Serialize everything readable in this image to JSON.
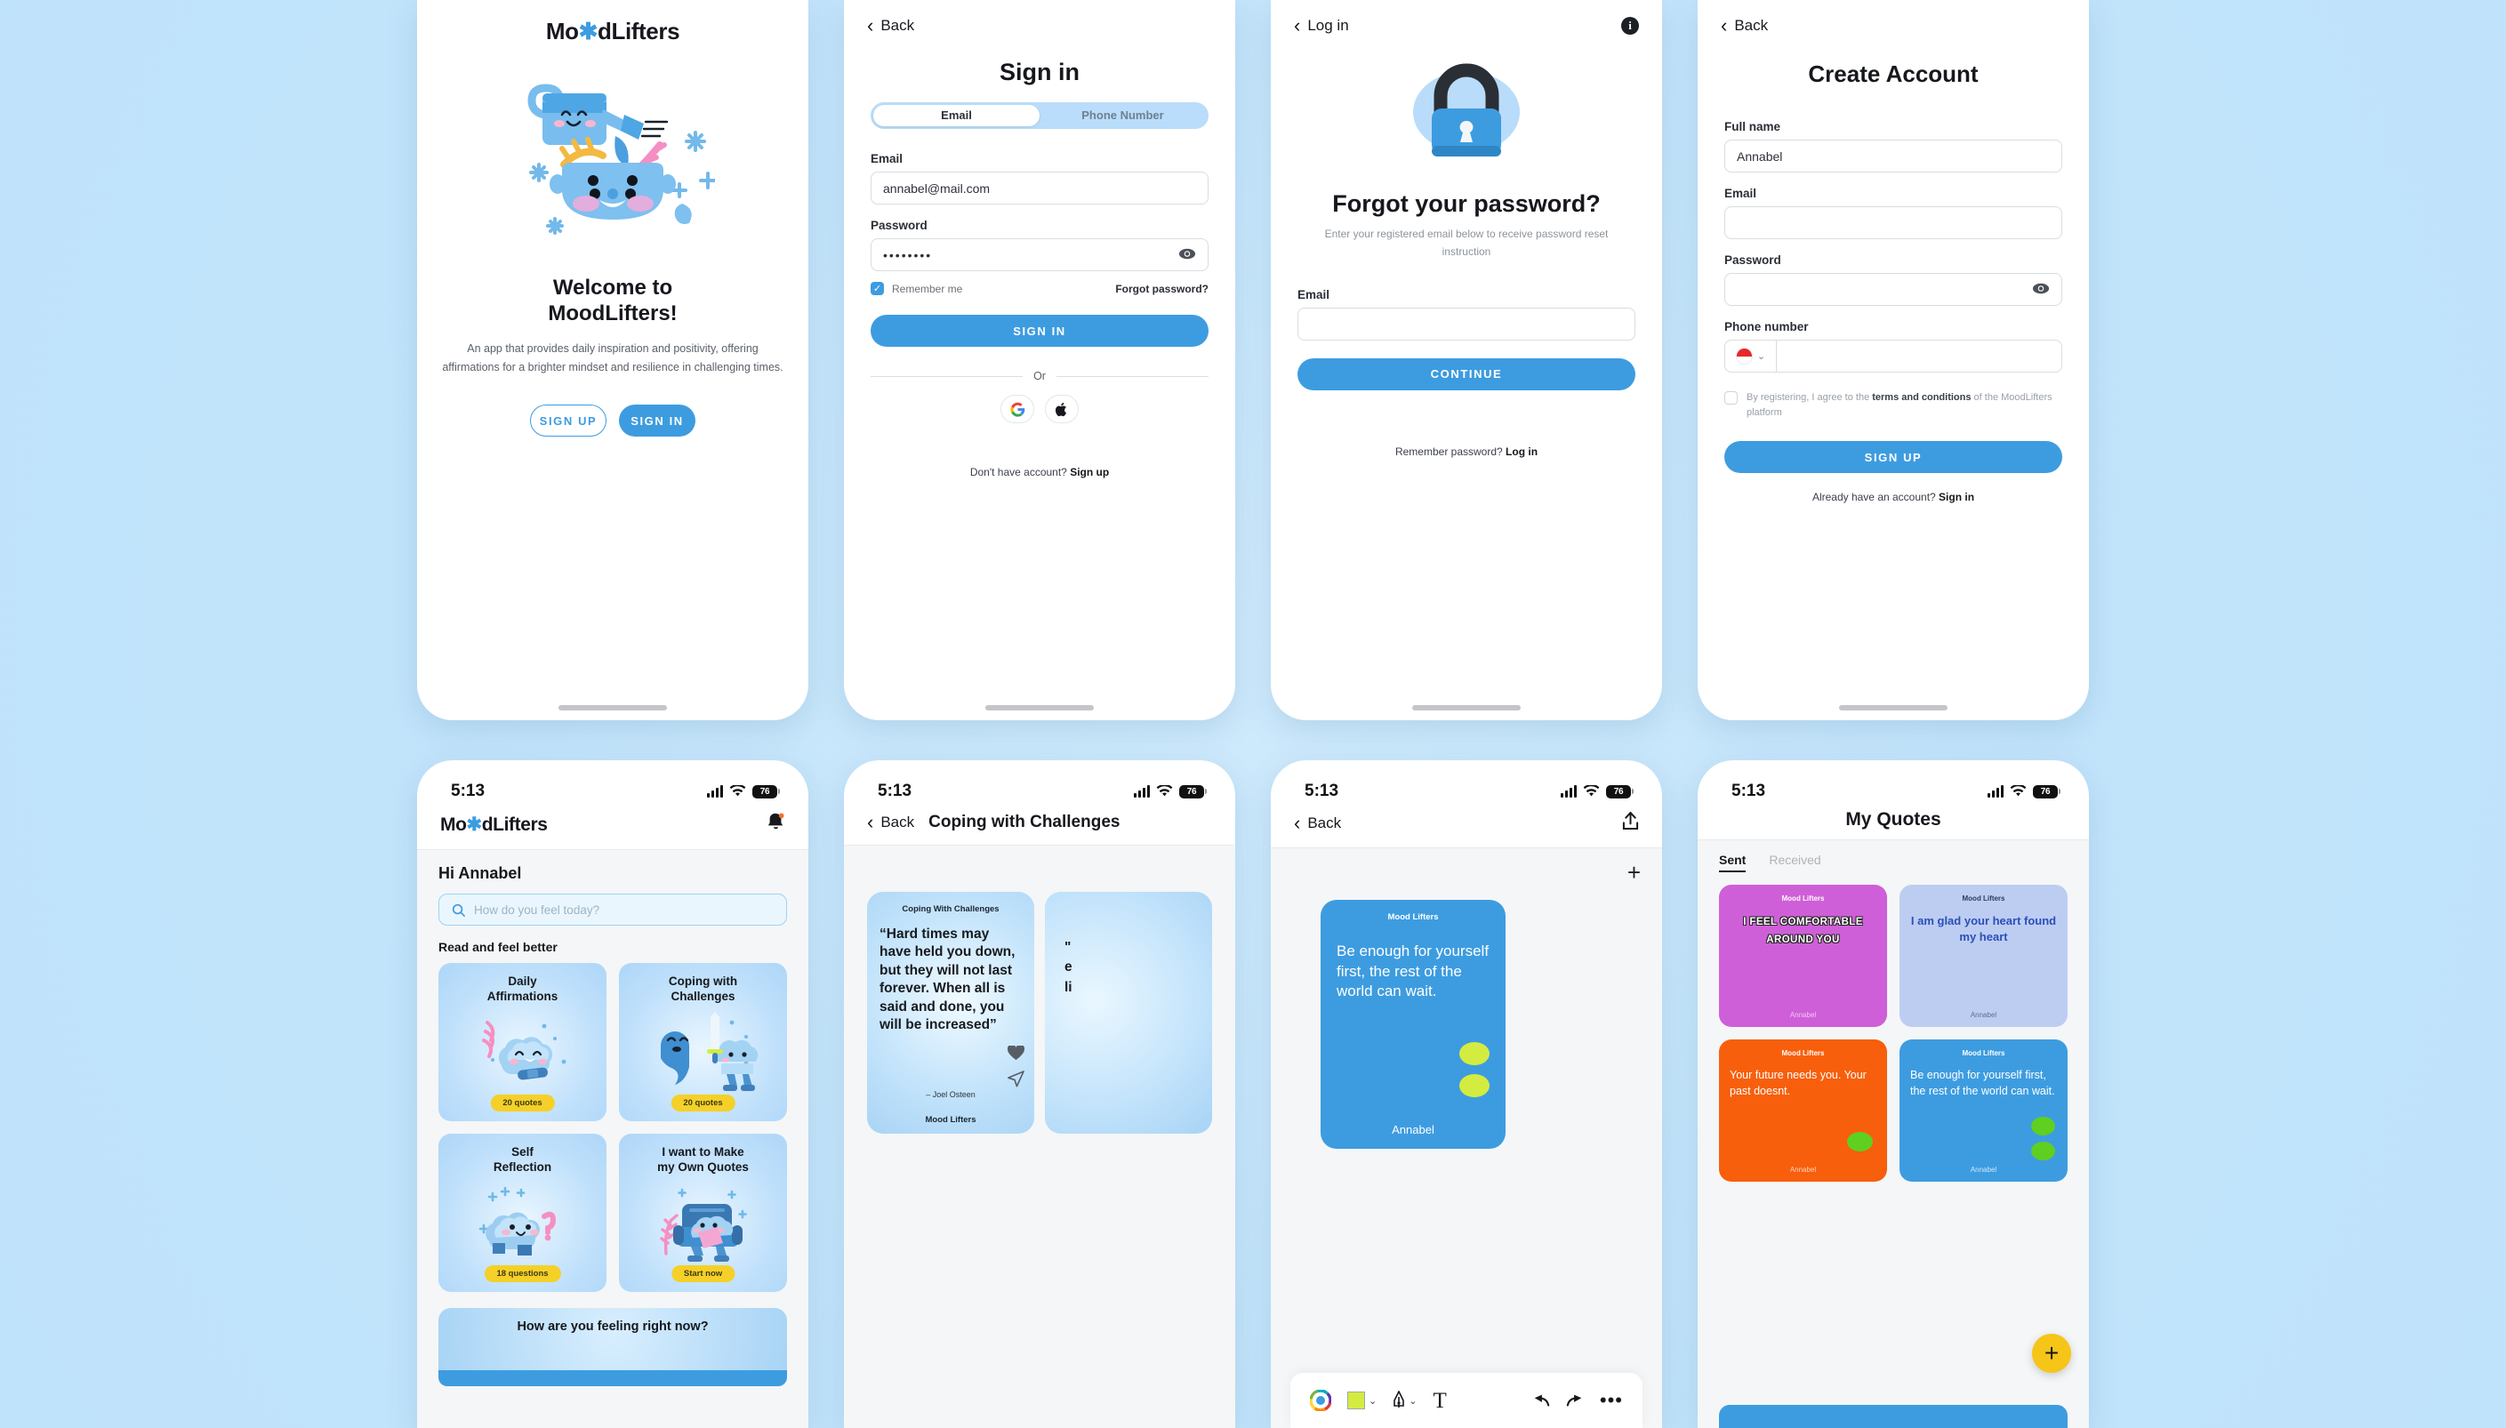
{
  "brand": {
    "name_part1": "Mo",
    "star": "✱",
    "name_part2": "dLifters",
    "accent": "#3d9ce0",
    "background": "#c2e4fb"
  },
  "status_bar": {
    "time": "5:13",
    "battery": "76"
  },
  "screen1_welcome": {
    "logo_part1": "Mo",
    "logo_star": "✱",
    "logo_part2": "dLifters",
    "title": "Welcome to\nMoodLifters!",
    "title_line1": "Welcome to",
    "title_line2": "MoodLifters!",
    "description": "An app that provides daily inspiration and positivity, offering affirmations for a brighter mindset and resilience in challenging times.",
    "sign_up": "SIGN UP",
    "sign_in": "SIGN IN"
  },
  "screen2_signin": {
    "back": "Back",
    "title": "Sign in",
    "tab_email": "Email",
    "tab_phone": "Phone Number",
    "email_label": "Email",
    "email_value": "annabel@mail.com",
    "password_label": "Password",
    "password_value": "••••••••",
    "remember_me": "Remember me",
    "forgot_password": "Forgot password?",
    "submit": "SIGN IN",
    "or": "Or",
    "social_google": "google-logo",
    "social_apple": "apple-logo",
    "footer_text": "Don't have account? ",
    "footer_link": "Sign up"
  },
  "screen3_forgot": {
    "back": "Log in",
    "info_icon": "i",
    "title": "Forgot your password?",
    "subtitle": "Enter your registered email below to receive password reset instruction",
    "email_label": "Email",
    "email_value": "",
    "submit": "CONTINUE",
    "footer_text": "Remember password? ",
    "footer_link": "Log in"
  },
  "screen4_signup": {
    "back": "Back",
    "title": "Create Account",
    "fullname_label": "Full name",
    "fullname_value": "Annabel",
    "email_label": "Email",
    "email_value": "",
    "password_label": "Password",
    "password_value": "",
    "phone_label": "Phone number",
    "phone_value": "",
    "terms_prefix": "By registering, I agree to the ",
    "terms_bold": "terms and conditions",
    "terms_suffix": " of the MoodLifters platform",
    "submit": "SIGN UP",
    "footer_text": "Already have an account? ",
    "footer_link": "Sign in"
  },
  "screen5_home": {
    "greeting": "Hi Annabel",
    "search_placeholder": "How do you feel today?",
    "section_title": "Read and feel better",
    "cards": [
      {
        "title_line1": "Daily",
        "title_line2": "Affirmations",
        "badge": "20 quotes"
      },
      {
        "title_line1": "Coping with",
        "title_line2": "Challenges",
        "badge": "20 quotes"
      },
      {
        "title_line1": "Self",
        "title_line2": "Reflection",
        "badge": "18 questions"
      },
      {
        "title_line1": "I want to Make",
        "title_line2": "my Own Quotes",
        "badge": "Start now"
      }
    ],
    "feeling_prompt": "How are you feeling right now?"
  },
  "screen6_coping": {
    "back": "Back",
    "title": "Coping with Challenges",
    "card": {
      "caption": "Coping With Challenges",
      "quote": "“Hard times may have held you down, but they will not last forever. When all is said and done, you will be increased”",
      "author": "– Joel Osteen",
      "brand": "Mood Lifters"
    },
    "card2_quote": "\" e li"
  },
  "screen7_editor": {
    "back": "Back",
    "share_icon": "share-icon",
    "add_icon": "+",
    "card": {
      "caption": "Mood Lifters",
      "quote": "Be enough for yourself first, the rest of the world can wait.",
      "author": "Annabel",
      "background": "#3d9ce0",
      "blob_color": "#d4ec3f"
    },
    "toolbar": {
      "color_wheel": "color-wheel-icon",
      "swatch": "#d4ec3f",
      "pen": "pen-icon",
      "text": "T",
      "undo": "undo-icon",
      "redo": "redo-icon",
      "more": "•••"
    }
  },
  "screen8_myquotes": {
    "title": "My Quotes",
    "tab_sent": "Sent",
    "tab_received": "Received",
    "fab": "+",
    "quotes": [
      {
        "caption": "Mood Lifters",
        "text": "I FEEL COMFORTABLE AROUND YOU",
        "author": "Annabel",
        "bg": "#cf5fd8",
        "color": "#ffffff",
        "style": "outline"
      },
      {
        "caption": "Mood Lifters",
        "text": "I am glad your heart found my heart",
        "author": "Annabel",
        "bg": "#bdcdf2",
        "color": "#2a50b8",
        "style": "bold-center"
      },
      {
        "caption": "Mood Lifters",
        "text": "Your future needs you. Your past doesnt.",
        "author": "Annabel",
        "bg": "#f75f0c",
        "color": "#ffffff",
        "style": "plain"
      },
      {
        "caption": "Mood Lifters",
        "text": "Be enough for yourself first, the rest of the world can wait.",
        "author": "Annabel",
        "bg": "#3d9ce0",
        "color": "#ffffff",
        "style": "plain"
      }
    ]
  }
}
